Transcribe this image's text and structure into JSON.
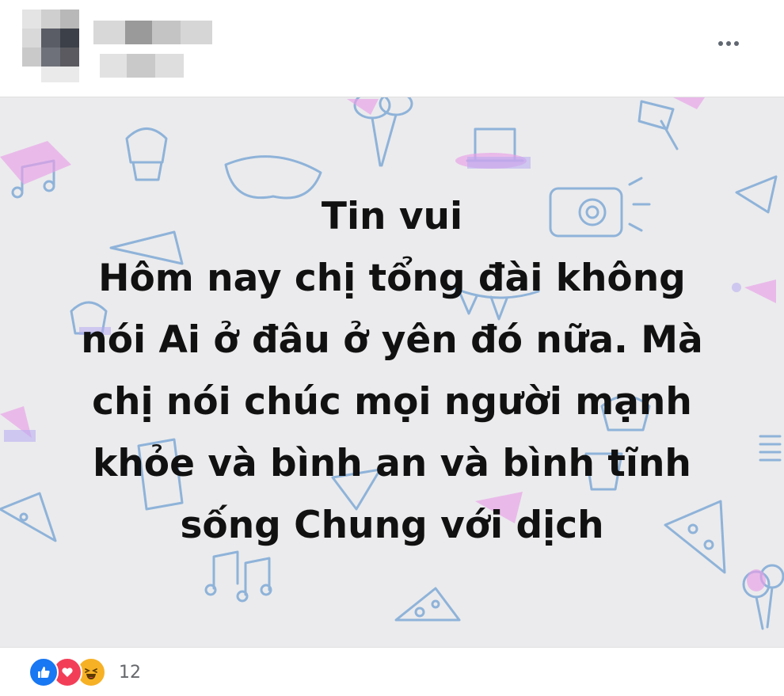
{
  "header": {
    "author_name_blurred": true,
    "more_options_icon": "ellipsis-icon"
  },
  "post": {
    "background_color": "#ebebed",
    "doodle_colors": [
      "#8fb3d9",
      "#e8a0e6",
      "#b6a9f0"
    ],
    "text_lines": [
      "Tin vui",
      "Hôm nay chị tổng đài không",
      "nói Ai ở đâu ở yên đó nữa. Mà",
      "chị nói chúc mọi người mạnh",
      "khỏe và bình an và bình tĩnh",
      "sống Chung với dịch"
    ]
  },
  "footer": {
    "reactions": [
      {
        "type": "like",
        "icon": "thumbs-up-icon",
        "color": "#1877f2"
      },
      {
        "type": "love",
        "icon": "heart-icon",
        "color": "#f33e58"
      },
      {
        "type": "haha",
        "icon": "laughing-face-icon",
        "color": "#f7b125"
      }
    ],
    "reaction_count": "12"
  }
}
